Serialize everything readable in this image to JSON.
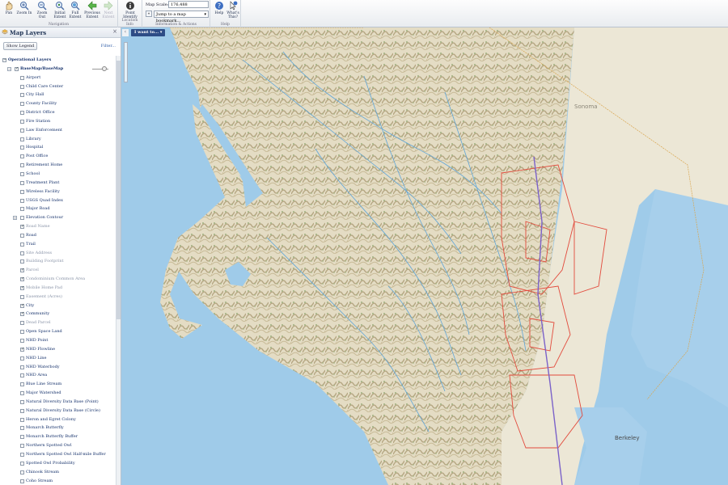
{
  "toolbar": {
    "navigation": {
      "caption": "Navigation",
      "buttons": [
        {
          "label": "Pan"
        },
        {
          "label": "Zoom In"
        },
        {
          "label": "Zoom Out"
        },
        {
          "label": "Initial Extent"
        },
        {
          "label": "Full Extent"
        },
        {
          "label": "Previous Extent"
        },
        {
          "label": "Next Extent"
        }
      ]
    },
    "location": {
      "caption": "Location Info",
      "button": "Point Identify"
    },
    "info": {
      "caption": "Information & Actions",
      "scale_label": "Map Scale: 1:",
      "scale_value": "176,488",
      "bookmark_arrow": "«",
      "bookmark_select": "Jump to a map bookmark..."
    },
    "help": {
      "caption": "Help",
      "help_label": "Help",
      "whats_this": "What's This?"
    }
  },
  "sidebar": {
    "title": "Map Layers",
    "show_legend": "Show Legend",
    "filter": "Filter...",
    "close": "×",
    "layers": [
      {
        "label": "Operational Layers",
        "indent": 0,
        "checked": false,
        "expand": "−",
        "bold": true
      },
      {
        "label": "BaseMap/BaseMap",
        "indent": 1,
        "checked": true,
        "expand": "−",
        "bold": true
      },
      {
        "label": "Airport",
        "indent": 2,
        "checked": false
      },
      {
        "label": "Child Care Center",
        "indent": 2,
        "checked": false
      },
      {
        "label": "City Hall",
        "indent": 2,
        "checked": false
      },
      {
        "label": "County Facility",
        "indent": 2,
        "checked": false
      },
      {
        "label": "District Office",
        "indent": 2,
        "checked": false
      },
      {
        "label": "Fire Station",
        "indent": 2,
        "checked": false
      },
      {
        "label": "Law Enforcement",
        "indent": 2,
        "checked": false
      },
      {
        "label": "Library",
        "indent": 2,
        "checked": false
      },
      {
        "label": "Hospital",
        "indent": 2,
        "checked": false
      },
      {
        "label": "Post Office",
        "indent": 2,
        "checked": false
      },
      {
        "label": "Retirement Home",
        "indent": 2,
        "checked": false
      },
      {
        "label": "School",
        "indent": 2,
        "checked": false
      },
      {
        "label": "Treatment Plant",
        "indent": 2,
        "checked": false
      },
      {
        "label": "Wireless Facility",
        "indent": 2,
        "checked": false
      },
      {
        "label": "USGS Quad Index",
        "indent": 2,
        "checked": false
      },
      {
        "label": "Major Road",
        "indent": 2,
        "checked": false
      },
      {
        "label": "Elevation Contour",
        "indent": 2,
        "checked": false,
        "expand": "+"
      },
      {
        "label": "Road Name",
        "indent": 2,
        "checked": true,
        "dim": true
      },
      {
        "label": "Road",
        "indent": 2,
        "checked": false
      },
      {
        "label": "Trail",
        "indent": 2,
        "checked": false
      },
      {
        "label": "Site Address",
        "indent": 2,
        "checked": false,
        "dim": true
      },
      {
        "label": "Building Footprint",
        "indent": 2,
        "checked": false,
        "dim": true
      },
      {
        "label": "Parcel",
        "indent": 2,
        "checked": true,
        "dim": true
      },
      {
        "label": "Condominium Common Area",
        "indent": 2,
        "checked": true,
        "dim": true
      },
      {
        "label": "Mobile Home Pad",
        "indent": 2,
        "checked": true,
        "dim": true
      },
      {
        "label": "Easement (Acres)",
        "indent": 2,
        "checked": false,
        "dim": true
      },
      {
        "label": "City",
        "indent": 2,
        "checked": true
      },
      {
        "label": "Community",
        "indent": 2,
        "checked": true
      },
      {
        "label": "Dead Parcel",
        "indent": 2,
        "checked": false,
        "dim": true
      },
      {
        "label": "Open Space Land",
        "indent": 2,
        "checked": false
      },
      {
        "label": "NHD Point",
        "indent": 2,
        "checked": false
      },
      {
        "label": "NHD Flowline",
        "indent": 2,
        "checked": true
      },
      {
        "label": "NHD Line",
        "indent": 2,
        "checked": false
      },
      {
        "label": "NHD Waterbody",
        "indent": 2,
        "checked": false
      },
      {
        "label": "NHD Area",
        "indent": 2,
        "checked": false
      },
      {
        "label": "Blue Line Stream",
        "indent": 2,
        "checked": false
      },
      {
        "label": "Major Watershed",
        "indent": 2,
        "checked": false
      },
      {
        "label": "Natural Diversity Data Base (Point)",
        "indent": 2,
        "checked": false
      },
      {
        "label": "Natural Diversity Data Base (Circle)",
        "indent": 2,
        "checked": false
      },
      {
        "label": "Heron and Egret Colony",
        "indent": 2,
        "checked": false
      },
      {
        "label": "Monarch Butterfly",
        "indent": 2,
        "checked": false
      },
      {
        "label": "Monarch Butterfly Buffer",
        "indent": 2,
        "checked": false
      },
      {
        "label": "Northern Spotted Owl",
        "indent": 2,
        "checked": false
      },
      {
        "label": "Northern Spotted Owl Half-mile Buffer",
        "indent": 2,
        "checked": false
      },
      {
        "label": "Spotted Owl Probability",
        "indent": 2,
        "checked": false
      },
      {
        "label": "Chinook Stream",
        "indent": 2,
        "checked": false
      },
      {
        "label": "Coho Stream",
        "indent": 2,
        "checked": false
      }
    ]
  },
  "map": {
    "i_want_to": "I want to...",
    "collapse": "‹",
    "place_labels": [
      "Sonoma",
      "Berkeley"
    ]
  },
  "colors": {
    "ocean": "#9fcbe9",
    "land": "#e9e4d3",
    "hills": "#b9ad8e",
    "rivers": "#5ea5d9",
    "city_boundary": "#e24a3c",
    "county_line": "#7b62c9",
    "accent": "#2d4c86"
  }
}
